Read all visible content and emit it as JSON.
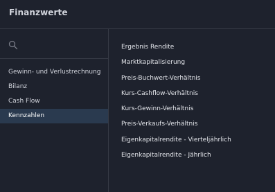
{
  "header": {
    "title": "Finanzwerte"
  },
  "search": {
    "icon": "search-icon",
    "value": "",
    "placeholder": ""
  },
  "categories": [
    {
      "label": "Gewinn- und Verlustrechnung",
      "selected": false
    },
    {
      "label": "Bilanz",
      "selected": false
    },
    {
      "label": "Cash Flow",
      "selected": false
    },
    {
      "label": "Kennzahlen",
      "selected": true
    }
  ],
  "items": [
    {
      "label": "Ergebnis Rendite"
    },
    {
      "label": "Marktkapitalisierung"
    },
    {
      "label": "Preis-Buchwert-Verhältnis"
    },
    {
      "label": "Kurs-Cashflow-Verhältnis"
    },
    {
      "label": "Kurs-Gewinn-Verhältnis"
    },
    {
      "label": "Preis-Verkaufs-Verhältnis"
    },
    {
      "label": "Eigenkapitalrendite - Vierteljährlich"
    },
    {
      "label": "Eigenkapitalrendite - Jährlich"
    }
  ],
  "colors": {
    "background": "#1e222d",
    "divider": "#363a45",
    "text": "#d1d4dc",
    "selected_background": "#2a3a4f"
  }
}
